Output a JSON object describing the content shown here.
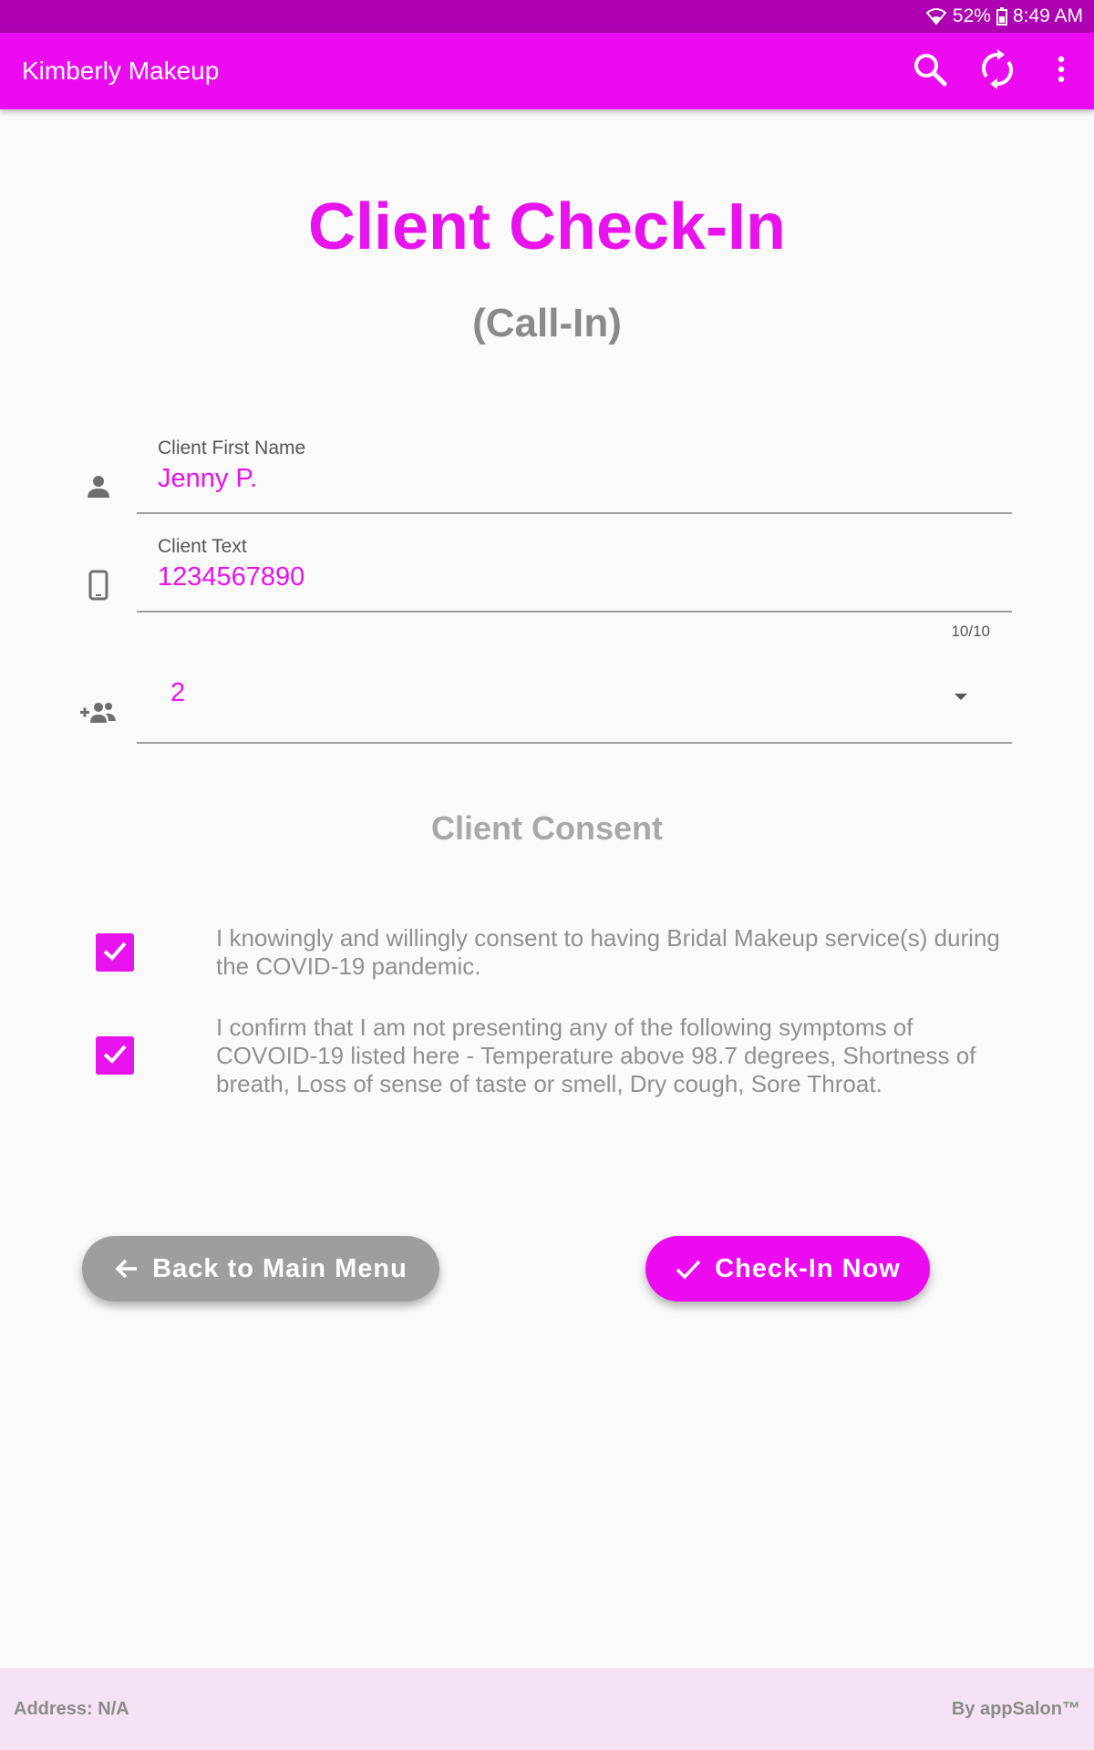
{
  "status_bar": {
    "battery": "52%",
    "time": "8:49 AM",
    "icons": [
      "wifi-icon",
      "battery-icon"
    ]
  },
  "app_bar": {
    "title": "Kimberly Makeup",
    "actions": [
      "search-icon",
      "refresh-icon",
      "more-vert-icon"
    ]
  },
  "header": {
    "title": "Client Check-In",
    "subtitle": "(Call-In)"
  },
  "form": {
    "first_name": {
      "label": "Client First Name",
      "value": "Jenny P.",
      "icon": "person-icon"
    },
    "phone": {
      "label": "Client Text",
      "value": "1234567890",
      "counter": "10/10",
      "icon": "phone-icon"
    },
    "party_size": {
      "value": "2",
      "icon": "group-add-icon"
    }
  },
  "consent": {
    "title": "Client Consent",
    "items": [
      {
        "checked": true,
        "text": "I knowingly and willingly consent to having Bridal Makeup service(s) during the COVID-19 pandemic."
      },
      {
        "checked": true,
        "text": "I confirm that I am not presenting any of the following symptoms of COVOID-19 listed here - Temperature above 98.7 degrees, Shortness of breath, Loss of sense of taste or smell, Dry cough, Sore Throat."
      }
    ]
  },
  "buttons": {
    "back": "Back to Main Menu",
    "checkin": "Check-In Now"
  },
  "footer": {
    "address": "Address: N/A",
    "brand": "By appSalon™"
  },
  "colors": {
    "accent": "#ec0af0",
    "status_bar": "#ad00b0",
    "footer_bg": "#f5e3f5"
  }
}
